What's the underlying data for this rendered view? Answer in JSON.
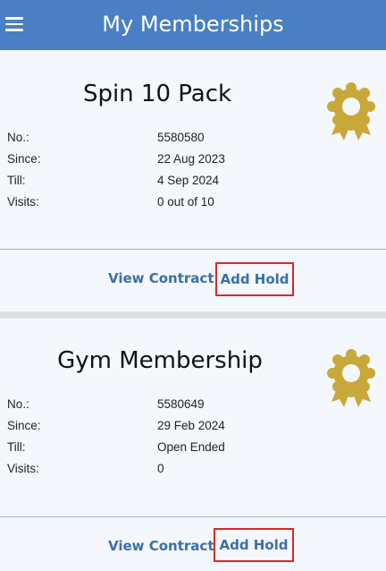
{
  "header": {
    "title": "My Memberships",
    "menu_icon": "hamburger-icon"
  },
  "labels": {
    "no": "No.:",
    "since": "Since:",
    "till": "Till:",
    "visits": "Visits:"
  },
  "memberships": [
    {
      "name": "Spin 10 Pack",
      "number": "5580580",
      "since": "22 Aug 2023",
      "till": "4 Sep 2024",
      "visits": "0 out of 10",
      "view_contract": "View Contract",
      "add_hold": "Add Hold"
    },
    {
      "name": "Gym Membership",
      "number": "5580649",
      "since": "29 Feb 2024",
      "till": "Open Ended",
      "visits": "0",
      "view_contract": "View Contract",
      "add_hold": "Add Hold"
    }
  ],
  "colors": {
    "appbar": "#4a7fc3",
    "badge": "#c9a83a",
    "link": "#3a6fa8",
    "highlight": "#d42a2a"
  }
}
